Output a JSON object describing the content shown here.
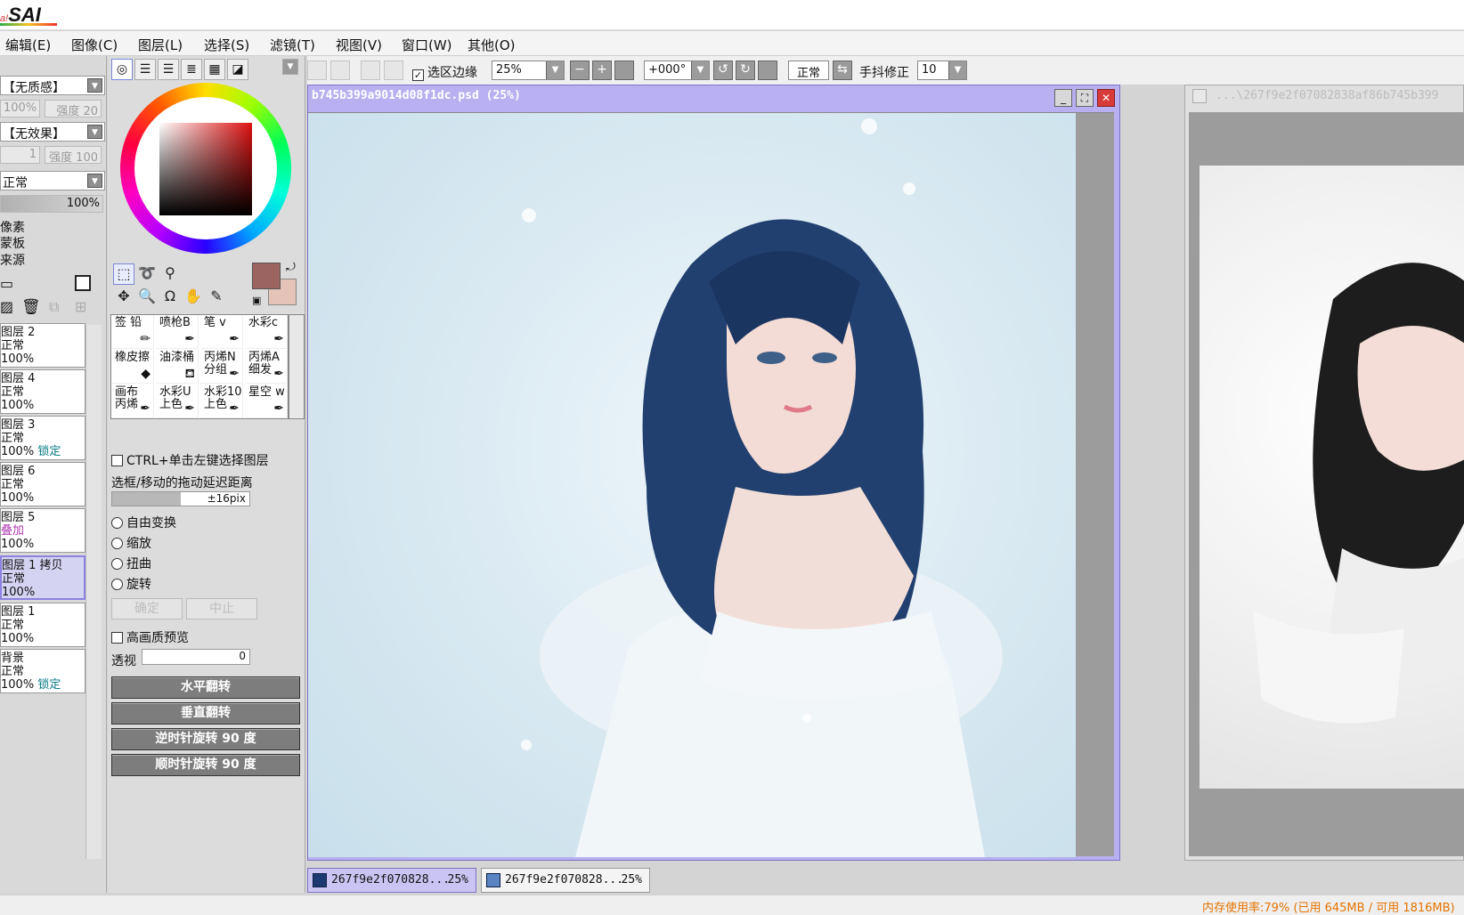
{
  "app": {
    "title": "SAI",
    "logo_prefix": "a!"
  },
  "menu": [
    "编辑(E)",
    "图像(C)",
    "图层(L)",
    "选择(S)",
    "滤镜(T)",
    "视图(V)",
    "窗口(W)",
    "其他(O)"
  ],
  "toolbar": {
    "selection_edge": "选区边缘",
    "zoom": "25%",
    "rotation": "+000°",
    "blend": "正常",
    "stabilizer_label": "手抖修正",
    "stabilizer_value": "10"
  },
  "left_panel": {
    "texture": "【无质感】",
    "texture_scale": "100%",
    "texture_strength": "强度 20",
    "effect": "【无效果】",
    "effect_scale": "1",
    "effect_strength": "强度 100",
    "blend_mode": "正常",
    "opacity": "100%",
    "options": [
      "像素",
      "蒙板",
      "来源"
    ],
    "layers": [
      {
        "name": "图层 2",
        "mode": "正常",
        "opacity": "100%",
        "lock": ""
      },
      {
        "name": "图层 4",
        "mode": "正常",
        "opacity": "100%",
        "lock": ""
      },
      {
        "name": "图层 3",
        "mode": "正常",
        "opacity": "100%",
        "lock": "锁定"
      },
      {
        "name": "图层 6",
        "mode": "正常",
        "opacity": "100%",
        "lock": ""
      },
      {
        "name": "图层 5",
        "mode": "叠加",
        "opacity": "100%",
        "lock": ""
      },
      {
        "name": "图层 1 拷贝",
        "mode": "正常",
        "opacity": "100%",
        "lock": ""
      },
      {
        "name": "图层 1",
        "mode": "正常",
        "opacity": "100%",
        "lock": ""
      },
      {
        "name": "背景",
        "mode": "正常",
        "opacity": "100%",
        "lock": "锁定"
      }
    ]
  },
  "colors": {
    "primary": "#9b6461",
    "secondary": "#e6c3b9"
  },
  "brushes": [
    {
      "name": "签 铅",
      "icon": "pencil-icon"
    },
    {
      "name": "喷枪B",
      "icon": "airbrush-icon"
    },
    {
      "name": "笔 v",
      "icon": "pen-icon"
    },
    {
      "name": "水彩c",
      "icon": "watercolor-icon"
    },
    {
      "name": "橡皮擦",
      "icon": "eraser-icon"
    },
    {
      "name": "油漆桶",
      "icon": "bucket-icon"
    },
    {
      "name": "丙烯N 分组",
      "icon": "brush-icon"
    },
    {
      "name": "丙烯A 细发",
      "icon": "brush-icon"
    },
    {
      "name": "画布 丙烯",
      "icon": "brush-icon"
    },
    {
      "name": "水彩U 上色",
      "icon": "brush-icon"
    },
    {
      "name": "水彩10 上色",
      "icon": "brush-icon"
    },
    {
      "name": "星空 w",
      "icon": "brush-icon"
    }
  ],
  "tool_options": {
    "ctrl_click": "CTRL+单击左键选择图层",
    "drag_delay_label": "选框/移动的拖动延迟距离",
    "drag_delay_value": "±16pix",
    "transforms": [
      "自由变换",
      "缩放",
      "扭曲",
      "旋转"
    ],
    "ok": "确定",
    "cancel": "中止",
    "hq_preview": "高画质预览",
    "perspective_label": "透视",
    "perspective_value": "0",
    "flip_h": "水平翻转",
    "flip_v": "垂直翻转",
    "rot_ccw": "逆时针旋转 90 度",
    "rot_cw": "顺时针旋转 90 度"
  },
  "windows": {
    "main_title": "b745b399a9014d08f1dc.psd (25%)",
    "second_title": "...\\267f9e2f07082838af86b745b399"
  },
  "doc_tabs": [
    {
      "name": "267f9e2f070828...",
      "zoom": "25%"
    },
    {
      "name": "267f9e2f070828...",
      "zoom": "25%"
    }
  ],
  "status": {
    "memory": "内存使用率:79% (已用 645MB / 可用 1816MB)"
  }
}
